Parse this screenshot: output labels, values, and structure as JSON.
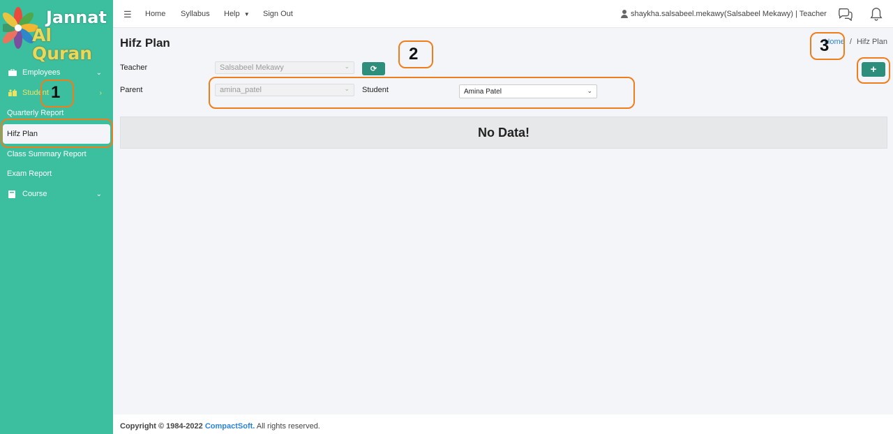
{
  "logo": {
    "line1": "Jannat",
    "line2": "Al Quran"
  },
  "sidebar": {
    "items": [
      {
        "label": "Employees",
        "icon": "briefcase-icon"
      },
      {
        "label": "Student",
        "icon": "students-icon"
      },
      {
        "label": "Quarterly Report"
      },
      {
        "label": "Hifz Plan"
      },
      {
        "label": "Class Summary Report"
      },
      {
        "label": "Exam Report"
      },
      {
        "label": "Course",
        "icon": "book-icon"
      }
    ]
  },
  "topbar": {
    "menu": [
      "Home",
      "Syllabus",
      "Help",
      "Sign Out"
    ],
    "user": "shaykha.salsabeel.mekawy(Salsabeel Mekawy) | Teacher"
  },
  "page": {
    "title": "Hifz Plan",
    "breadcrumb": {
      "home": "Home",
      "sep": "/",
      "current": "Hifz Plan"
    }
  },
  "form": {
    "teacher_label": "Teacher",
    "teacher_value": "Salsabeel Mekawy",
    "parent_label": "Parent",
    "parent_value": "amina_patel",
    "student_label": "Student",
    "student_value": "Amina Patel",
    "add_label": "+"
  },
  "empty_message": "No Data!",
  "footer": {
    "prefix": "Copyright © 1984-2022 ",
    "brand": "CompactSoft.",
    "suffix": " All rights reserved."
  },
  "annotations": [
    "1",
    "2",
    "3"
  ],
  "colors": {
    "sidebar": "#3bbf9f",
    "button": "#2d8e7c",
    "annotation": "#f07d1c",
    "link": "#2c82d8"
  }
}
